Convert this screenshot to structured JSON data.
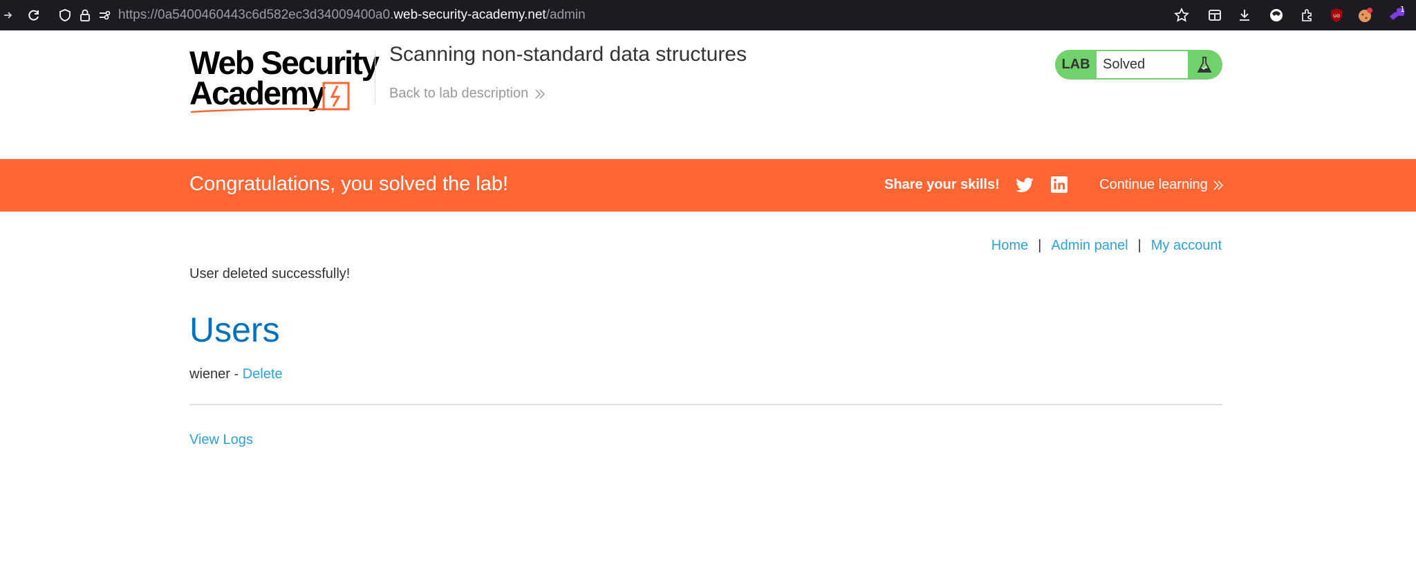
{
  "browser": {
    "url_prefix": "https://0a5400460443c6d582ec3d34009400a0.",
    "url_host": "web-security-academy.net",
    "url_path": "/admin",
    "extension_badge": "1"
  },
  "header": {
    "logo_line1": "Web Security",
    "logo_line2": "Academy",
    "lab_title": "Scanning non-standard data structures",
    "back_link": "Back to lab description"
  },
  "lab_status": {
    "label": "LAB",
    "status": "Solved"
  },
  "banner": {
    "congrats": "Congratulations, you solved the lab!",
    "share": "Share your skills!",
    "continue": "Continue learning"
  },
  "nav": {
    "home": "Home",
    "separator": "|",
    "admin_panel": "Admin panel",
    "my_account": "My account"
  },
  "content": {
    "message": "User deleted successfully!",
    "heading": "Users",
    "user_name": "wiener",
    "user_sep": " - ",
    "delete": "Delete",
    "view_logs": "View Logs"
  },
  "colors": {
    "accent": "#ff6633",
    "link": "#29a3d8",
    "heading": "#0071bc",
    "solved": "#70d16d"
  }
}
